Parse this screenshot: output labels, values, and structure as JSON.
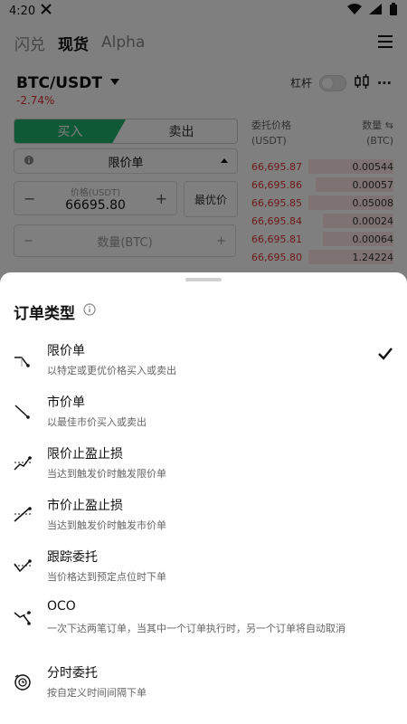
{
  "status_bar": {
    "time": "4:20"
  },
  "tabs": [
    {
      "label": "闪兑"
    },
    {
      "label": "现货"
    },
    {
      "label": "Alpha"
    }
  ],
  "pair": {
    "name": "BTC/USDT",
    "change": "-2.74%",
    "leverage_label": "杠杆"
  },
  "trade": {
    "buy_label": "买入",
    "sell_label": "卖出",
    "order_type": "限价单",
    "price_label": "价格(USDT)",
    "price_value": "66695.80",
    "best_price_label": "最优价",
    "qty_placeholder": "数量(BTC)"
  },
  "orderbook": {
    "price_header": "委托价格",
    "price_unit": "(USDT)",
    "qty_header": "数量 ⇆",
    "qty_unit": "(BTC)",
    "rows": [
      {
        "price": "66,695.87",
        "qty": "0.00544",
        "depth": 0.6
      },
      {
        "price": "66,695.86",
        "qty": "0.00057",
        "depth": 0.55
      },
      {
        "price": "66,695.85",
        "qty": "0.05008",
        "depth": 0.6
      },
      {
        "price": "66,695.84",
        "qty": "0.00024",
        "depth": 0.5
      },
      {
        "price": "66,695.81",
        "qty": "0.00064",
        "depth": 0.5
      },
      {
        "price": "66,695.80",
        "qty": "1.24224",
        "depth": 0.6
      }
    ]
  },
  "sheet": {
    "title": "订单类型",
    "options": [
      {
        "title": "限价单",
        "desc": "以特定或更优价格买入或卖出",
        "selected": true,
        "icon": "limit-icon"
      },
      {
        "title": "市价单",
        "desc": "以最佳市价买入或卖出",
        "selected": false,
        "icon": "market-icon"
      },
      {
        "title": "限价止盈止损",
        "desc": "当达到触发价时触发限价单",
        "selected": false,
        "icon": "limit-tpsl-icon"
      },
      {
        "title": "市价止盈止损",
        "desc": "当达到触发价时触发市价单",
        "selected": false,
        "icon": "market-tpsl-icon"
      },
      {
        "title": "跟踪委托",
        "desc": "当价格达到预定点位时下单",
        "selected": false,
        "icon": "trailing-icon"
      },
      {
        "title": "OCO",
        "desc": "一次下达两笔订单，当其中一个订单执行时，另一个订单将自动取消",
        "selected": false,
        "icon": "oco-icon"
      },
      {
        "title": "分时委托",
        "desc": "按自定义时间间隔下单",
        "selected": false,
        "icon": "twap-icon"
      }
    ]
  },
  "colors": {
    "buy": "#20b26c",
    "sell_price": "#dd3333",
    "overlay": "rgba(0,0,0,0.5)"
  }
}
